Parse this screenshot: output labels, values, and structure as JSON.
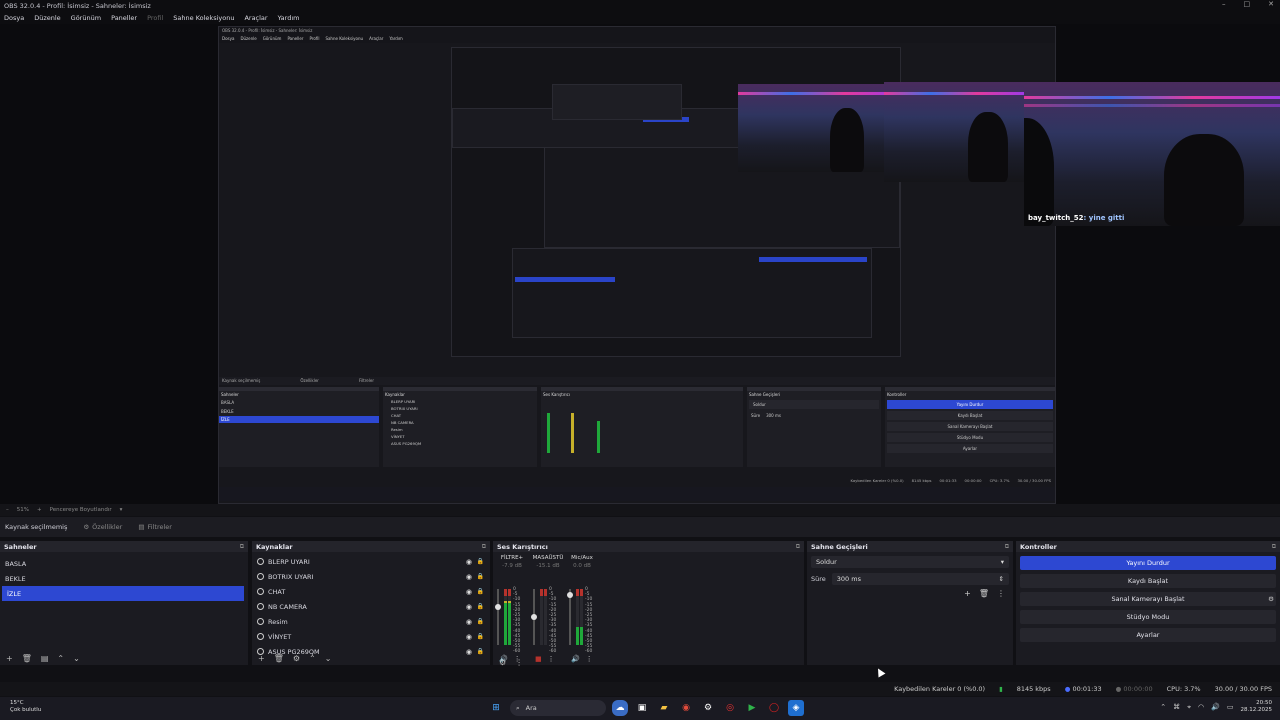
{
  "window": {
    "title": "OBS 32.0.4 - Profil: İsimsiz - Sahneler: İsimsiz",
    "controls": [
      "–",
      "□",
      "✕"
    ]
  },
  "menu": [
    "Dosya",
    "Düzenle",
    "Görünüm",
    "Paneller",
    "Profil",
    "Sahne Koleksiyonu",
    "Araçlar",
    "Yardım"
  ],
  "nested_window": {
    "title": "OBS 32.0.4 - Profil: İsimsiz - Sahneler: İsimsiz",
    "menu": [
      "Dosya",
      "Düzenle",
      "Görünüm",
      "Paneller",
      "Profil",
      "Sahne Koleksiyonu",
      "Araçlar",
      "Yardım"
    ],
    "source_label": "Kaynak seçilmemiş",
    "props": "Özellikler",
    "filters": "Filtreler",
    "scenes_title": "Sahneler",
    "scenes": [
      "BASLA",
      "BEKLE",
      "İZLE"
    ],
    "sources_title": "Kaynaklar",
    "sources": [
      "BLERP UYARI",
      "BOTRIX UYARI",
      "CHAT",
      "NB CAMERA",
      "Resim",
      "VİNYET",
      "ASUS PG269QM"
    ],
    "mixer_title": "Ses Karıştırıcı",
    "trans_title": "Sahne Geçişleri",
    "trans_value": "Soldur",
    "trans_dur_label": "Süre",
    "trans_dur": "300 ms",
    "controls_title": "Kontroller",
    "controls": [
      "Yayını Durdur",
      "Kaydı Başlat",
      "Sanal Kamerayı Başlat",
      "Stüdyo Modu",
      "Ayarlar"
    ],
    "status": [
      "Kaybedilen Kareler 0 (%0.0)",
      "8145 kbps",
      "00:01:33",
      "00:00:00",
      "CPU: 3.7%",
      "30.00 / 30.00 FPS"
    ]
  },
  "webcam": {
    "chat_user": "bay_twitch_52",
    "chat_msg": ": yine gitti"
  },
  "zoom": {
    "value": "51%",
    "mode": "Pencereye Boyutlandır"
  },
  "source_bar": {
    "label": "Kaynak seçilmemiş",
    "properties": "Özellikler",
    "filters": "Filtreler"
  },
  "scenes": {
    "title": "Sahneler",
    "items": [
      "BASLA",
      "BEKLE",
      "İZLE"
    ],
    "selected": 2
  },
  "sources": {
    "title": "Kaynaklar",
    "items": [
      "BLERP UYARI",
      "BOTRIX UYARI",
      "CHAT",
      "NB CAMERA",
      "Resim",
      "VİNYET",
      "ASUS PG269QM"
    ]
  },
  "mixer": {
    "title": "Ses Karıştırıcı",
    "channels": [
      {
        "name": "FİLTRE+",
        "db": "-7.9 dB",
        "level": 0.78,
        "fader": 0.7
      },
      {
        "name": "MASAÜSTÜ",
        "db": "-15.1 dB",
        "level": 0.0,
        "fader": 0.5
      },
      {
        "name": "Mic/Aux",
        "db": "0.0 dB",
        "level": 0.33,
        "fader": 0.95
      }
    ],
    "ticks": [
      "0",
      "-5",
      "-10",
      "-15",
      "-20",
      "-25",
      "-30",
      "-35",
      "-40",
      "-45",
      "-50",
      "-55",
      "-60"
    ]
  },
  "transitions": {
    "title": "Sahne Geçişleri",
    "value": "Soldur",
    "duration_label": "Süre",
    "duration": "300 ms"
  },
  "controls": {
    "title": "Kontroller",
    "stop_stream": "Yayını Durdur",
    "start_record": "Kaydı Başlat",
    "virtual_cam": "Sanal Kamerayı Başlat",
    "studio_mode": "Stüdyo Modu",
    "settings": "Ayarlar"
  },
  "status": {
    "dropped": "Kaybedilen Kareler 0 (%0.0)",
    "bitrate": "8145 kbps",
    "stream_time": "00:01:33",
    "record_time": "00:00:00",
    "cpu": "CPU: 3.7%",
    "fps": "30.00 / 30.00 FPS"
  },
  "taskbar": {
    "weather_temp": "15°C",
    "weather_desc": "Çok bulutlu",
    "search_placeholder": "Ara",
    "time": "20:50",
    "date": "28.12.2025"
  },
  "colors": {
    "accent": "#2d48d2",
    "panel": "#1b1b21",
    "bg": "#101014",
    "meter_green": "#1fa83a",
    "meter_red": "#b5322c"
  }
}
